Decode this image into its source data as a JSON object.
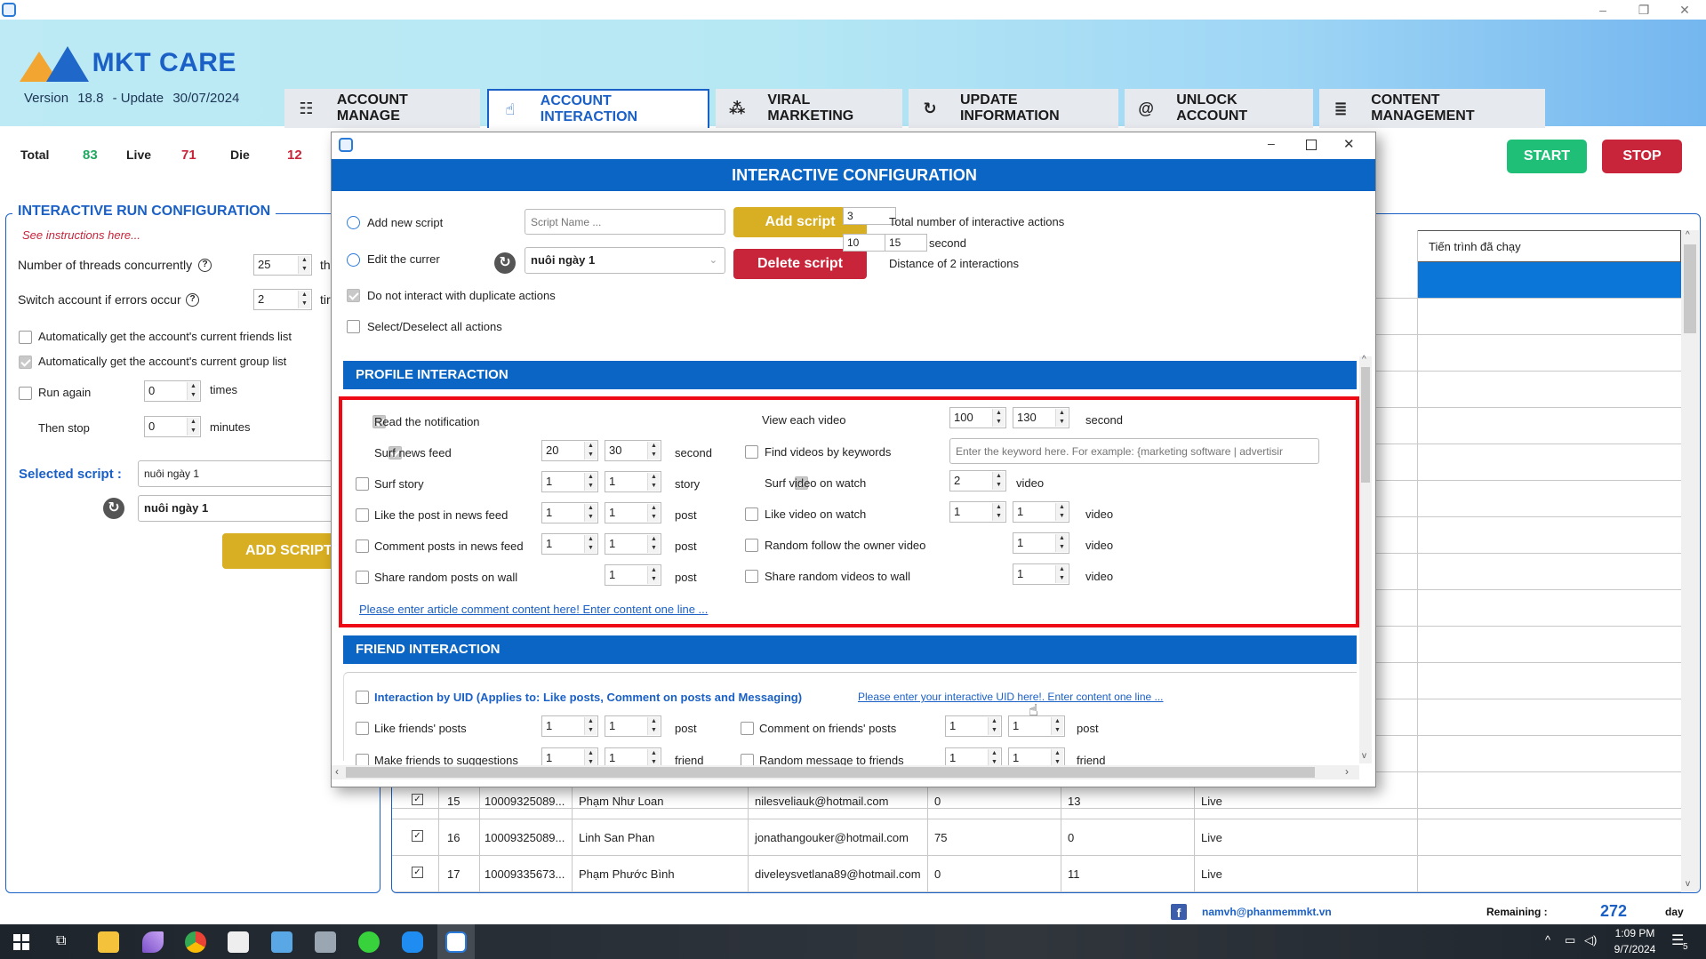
{
  "window": {
    "minimize": "–",
    "restore": "❐",
    "close": "✕"
  },
  "header": {
    "logo_text": "MKT CARE",
    "version_label": "Version",
    "version": "18.8",
    "update_label": "- Update",
    "update_date": "30/07/2024",
    "tabs": [
      {
        "label": "ACCOUNT MANAGE",
        "icon": "list-search-icon",
        "glyph": "☷"
      },
      {
        "label": "ACCOUNT INTERACTION",
        "icon": "hand-pointer-icon",
        "glyph": "☝"
      },
      {
        "label": "VIRAL MARKETING",
        "icon": "nodes-icon",
        "glyph": "⁂"
      },
      {
        "label": "UPDATE INFORMATION",
        "icon": "refresh-check-icon",
        "glyph": "↻"
      },
      {
        "label": "UNLOCK ACCOUNT",
        "icon": "fingerprint-icon",
        "glyph": "@"
      },
      {
        "label": "CONTENT MANAGEMENT",
        "icon": "document-icon",
        "glyph": "≣"
      }
    ],
    "active_tab": 1
  },
  "stats": {
    "total_label": "Total",
    "total": "83",
    "live_label": "Live",
    "live": "71",
    "die_label": "Die",
    "die": "12"
  },
  "actions": {
    "start": "START",
    "stop": "STOP"
  },
  "left_panel": {
    "title": "INTERACTIVE RUN CONFIGURATION",
    "help_link": "See instructions here...",
    "threads_label": "Number of threads concurrently",
    "threads_value": "25",
    "threads_unit": "th",
    "switch_label": "Switch account if errors occur",
    "switch_value": "2",
    "switch_unit": "tir",
    "auto_friends": {
      "label": "Automatically get the account's current friends list",
      "checked": false
    },
    "auto_groups": {
      "label": "Automatically get the account's current group list",
      "checked": true
    },
    "run_again": {
      "label": "Run again",
      "value": "0",
      "unit": "times",
      "checked": false
    },
    "then_stop": {
      "label": "Then stop",
      "value": "0",
      "unit": "minutes"
    },
    "selected_script_label": "Selected script :",
    "selected_script_value": "nuôi ngày 1",
    "script_dropdown_value": "nuôi ngày 1",
    "add_script_button": "ADD SCRIPT"
  },
  "grid": {
    "last_column_header": "Tiến trình đã chạy",
    "rows": [
      {
        "checked": true,
        "no": "15",
        "uid": "10009325089...",
        "name": "Phạm Như Loan",
        "email": "nilesveliauk@hotmail.com",
        "c1": "0",
        "c2": "13",
        "status": "Live"
      },
      {
        "checked": true,
        "no": "16",
        "uid": "10009325089...",
        "name": "Linh San Phan",
        "email": "jonathangouker@hotmail.com",
        "c1": "75",
        "c2": "0",
        "status": "Live"
      },
      {
        "checked": true,
        "no": "17",
        "uid": "10009335673...",
        "name": "Phạm Phước Bình",
        "email": "diveleysvetlana89@hotmail.com",
        "c1": "0",
        "c2": "11",
        "status": "Live"
      }
    ]
  },
  "dialog": {
    "title": "INTERACTIVE CONFIGURATION",
    "add_new_script_label": "Add new script",
    "script_name_placeholder": "Script Name ...",
    "add_script_button": "Add script",
    "edit_current_label": "Edit the currer",
    "current_script": "nuôi ngày 1",
    "delete_script_button": "Delete script",
    "total_actions_value": "3",
    "total_actions_label": "Total number of interactive actions",
    "distance_min": "10",
    "distance_max": "15",
    "distance_unit": "second",
    "distance_label": "Distance of 2 interactions",
    "no_duplicate": {
      "label": "Do not interact with duplicate actions",
      "checked": true
    },
    "select_all": {
      "label": "Select/Deselect all actions",
      "checked": false
    },
    "profile": {
      "title": "PROFILE INTERACTION",
      "left": [
        {
          "label": "Read the notification",
          "checked": true
        },
        {
          "label": "Surf news feed",
          "checked": true,
          "min": "20",
          "max": "30",
          "unit": "second"
        },
        {
          "label": "Surf story",
          "checked": false,
          "min": "1",
          "max": "1",
          "unit": "story"
        },
        {
          "label": "Like the post in news feed",
          "checked": false,
          "min": "1",
          "max": "1",
          "unit": "post"
        },
        {
          "label": "Comment posts in news feed",
          "checked": false,
          "min": "1",
          "max": "1",
          "unit": "post"
        },
        {
          "label": "Share random posts on wall",
          "checked": false,
          "max": "1",
          "unit": "post"
        }
      ],
      "comment_link": "Please enter article comment content here!  Enter content one line ...",
      "view_video": {
        "label": "View each video",
        "min": "100",
        "max": "130",
        "unit": "second"
      },
      "find_videos": {
        "label": "Find videos by keywords",
        "checked": false,
        "placeholder": "Enter the keyword here. For example: {marketing software | advertisir"
      },
      "surf_video": {
        "label": "Surf video on watch",
        "checked": true,
        "value": "2",
        "unit": "video"
      },
      "like_video": {
        "label": "Like video on watch",
        "checked": false,
        "min": "1",
        "max": "1",
        "unit": "video"
      },
      "follow_owner": {
        "label": "Random follow the owner video",
        "checked": false,
        "value": "1",
        "unit": "video"
      },
      "share_videos": {
        "label": "Share random videos to wall",
        "checked": false,
        "value": "1",
        "unit": "video"
      }
    },
    "friend": {
      "title": "FRIEND INTERACTION",
      "by_uid": {
        "label": "Interaction by UID (Applies to: Like posts, Comment on posts and Messaging)",
        "checked": false
      },
      "uid_link": "Please enter your interactive UID here!.  Enter content one line ...",
      "like_friends": {
        "label": "Like friends' posts",
        "checked": false,
        "min": "1",
        "max": "1",
        "unit": "post"
      },
      "comment_friends": {
        "label": "Comment on friends' posts",
        "checked": false,
        "min": "1",
        "max": "1",
        "unit": "post"
      },
      "make_friends": {
        "label": "Make friends to suggestions",
        "checked": false,
        "min": "1",
        "max": "1",
        "unit": "friend"
      },
      "message_friends": {
        "label": "Random message to friends",
        "checked": false,
        "min": "1",
        "max": "1",
        "unit": "friend"
      }
    }
  },
  "footer": {
    "email": "namvh@phanmemmkt.vn",
    "remaining_label": "Remaining :",
    "remaining_value": "272",
    "remaining_unit": "day"
  },
  "taskbar": {
    "time": "1:09 PM",
    "date": "9/7/2024",
    "notification_count": "5",
    "apps": [
      "windows-start",
      "task-view",
      "file-explorer",
      "feather-app",
      "chrome",
      "app-grid",
      "screen-app",
      "monitor-app",
      "green-app",
      "zalo",
      "mkt-care"
    ]
  }
}
